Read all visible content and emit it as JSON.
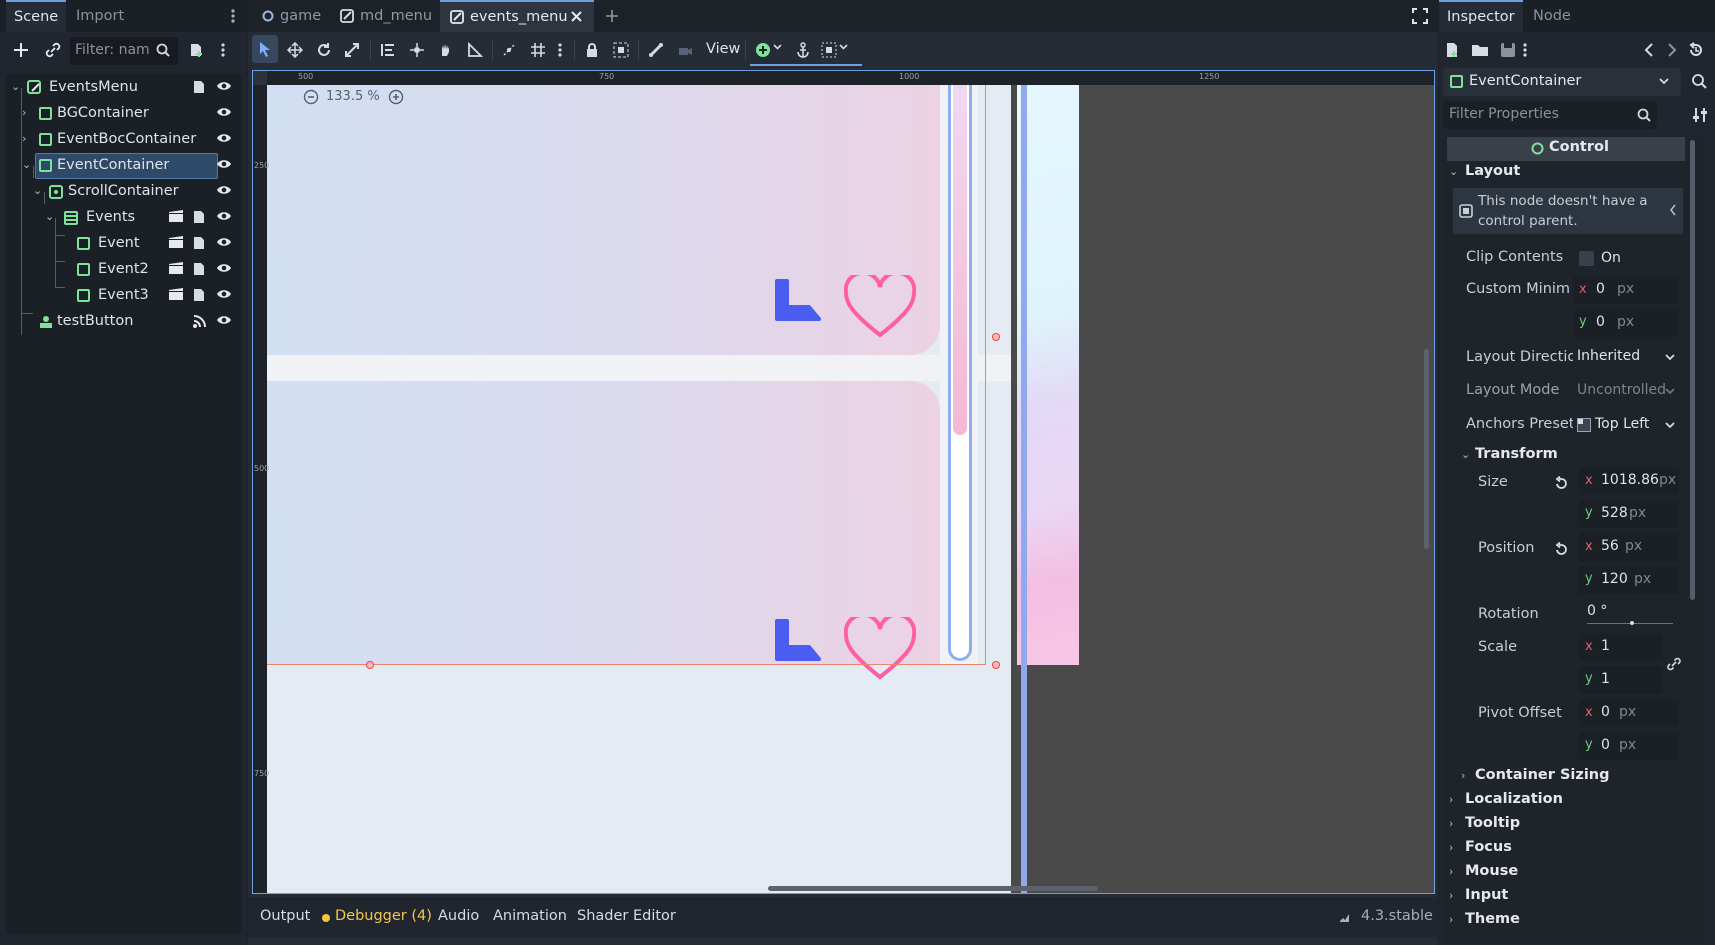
{
  "left_dock": {
    "tabs": [
      "Scene",
      "Import"
    ],
    "filter_placeholder": "Filter: nam",
    "tree": [
      {
        "label": "EventsMenu",
        "depth": 0
      },
      {
        "label": "BGContainer",
        "depth": 1
      },
      {
        "label": "EventBocContainer",
        "depth": 1
      },
      {
        "label": "EventContainer",
        "depth": 1,
        "selected": true
      },
      {
        "label": "ScrollContainer",
        "depth": 2
      },
      {
        "label": "Events",
        "depth": 3
      },
      {
        "label": "Event",
        "depth": 4
      },
      {
        "label": "Event2",
        "depth": 4
      },
      {
        "label": "Event3",
        "depth": 4
      },
      {
        "label": "testButton",
        "depth": 1
      }
    ]
  },
  "editor": {
    "scene_tabs": [
      "game",
      "md_menu",
      "events_menu"
    ],
    "view_menu": "View",
    "zoom_label": "133.5 %",
    "ruler_h": [
      "500",
      "750",
      "1000",
      "1250"
    ],
    "ruler_v": [
      "250",
      "500",
      "750"
    ]
  },
  "bottom_panel": {
    "tabs": [
      "Output",
      "Debugger (4)",
      "Audio",
      "Animation",
      "Shader Editor"
    ],
    "version": "4.3.stable",
    "debugger_dot_color": "#f5c542"
  },
  "inspector": {
    "tabs": [
      "Inspector",
      "Node"
    ],
    "node_name": "EventContainer",
    "filter_placeholder": "Filter Properties",
    "class_name": "Control",
    "layout_section": "Layout",
    "warning": "This node doesn't have a control parent.",
    "clip_contents_label": "Clip Contents",
    "clip_contents_value": "On",
    "custom_min_label": "Custom Minim",
    "custom_min_x": "0",
    "custom_min_y": "0",
    "layout_direction_label": "Layout Directio",
    "layout_direction_value": "Inherited",
    "layout_mode_label": "Layout Mode",
    "layout_mode_value": "Uncontrolled",
    "anchors_preset_label": "Anchors Preset",
    "anchors_preset_value": "Top Left",
    "transform_section": "Transform",
    "size_label": "Size",
    "size_x": "1018.86",
    "size_y": "528",
    "position_label": "Position",
    "position_x": "56",
    "position_y": "120",
    "rotation_label": "Rotation",
    "rotation_value": "0 °",
    "scale_label": "Scale",
    "scale_x": "1",
    "scale_y": "1",
    "pivot_label": "Pivot Offset",
    "pivot_x": "0",
    "pivot_y": "0",
    "unit_px": "px",
    "axis_x": "x",
    "axis_y": "y",
    "collapsed_subsection": "Container Sizing",
    "collapsed_sections": [
      "Localization",
      "Tooltip",
      "Focus",
      "Mouse",
      "Input",
      "Theme"
    ]
  },
  "colors": {
    "accent": "#6e9fe3",
    "node_green": "#7be39a",
    "heart_pink": "#ff5fa2",
    "arrow_blue": "#4b5cf0"
  }
}
